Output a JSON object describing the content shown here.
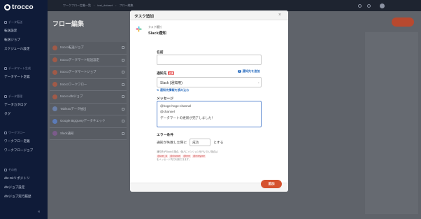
{
  "app": {
    "logo": "trocco"
  },
  "sidebar": {
    "sections": [
      {
        "label": "データ転送",
        "items": [
          "転送設定",
          "転送ジョブ",
          "スケジュール設定"
        ]
      },
      {
        "label": "データマート生成",
        "items": [
          "データマート定義"
        ]
      },
      {
        "label": "データ管理",
        "items": [
          "データカタログ",
          "タグ"
        ]
      },
      {
        "label": "ワークフロー",
        "items": [
          "ワークフロー定義",
          "ワークフロージョブ"
        ]
      },
      {
        "label": "その他",
        "items": [
          "dbt Gitリポジトリ",
          "dbtジョブ設定",
          "dbtジョブ実行履歴"
        ]
      }
    ],
    "collapse": "«"
  },
  "header": {
    "breadcrumb": [
      "ワークフロー定義一覧",
      "test_dataset",
      "フロー編集"
    ]
  },
  "page": {
    "title": "フロー編集",
    "add_label": "追加"
  },
  "background_tasks": [
    "trocco転送ジョブ",
    "troccoデータマート転送設定",
    "troccoデータマートジョブ",
    "troccoワークフロー",
    "trocco dbtジョブ",
    "Tableauデータ抽出",
    "Google BigQueryデータチェック",
    "Slack通知"
  ],
  "modal": {
    "title": "タスク追加",
    "close": "×",
    "task_type_label": "タスク種別",
    "task_type_name": "Slack通知",
    "name_label": "名前",
    "name_value": "",
    "dest_label": "通知先",
    "required": "必須",
    "add_dest": "通知先を追加",
    "dest_value": "Slack (通知用)",
    "reload": "通知先情報を読み込む",
    "message_label": "メッセージ",
    "message_lines": [
      "@hoge-hoge-channel",
      "@channel",
      "データマートの更新が完了しました！"
    ],
    "error_label": "エラー条件",
    "error_prefix": "通知が失敗した際に",
    "error_value": "成功",
    "error_suffix": "とする",
    "help_text": "通知先がSlackの場合、個人にメンションを行いたい場合は",
    "help_chips": [
      "@user_id",
      "@channel",
      "@here",
      "@everyone"
    ],
    "help_rest": "をメッセージ内で利用できます。",
    "submit": "追加"
  },
  "colors": {
    "brand": "#d5522f",
    "link": "#2d6fc0",
    "sidebar": "#0f1b38"
  }
}
